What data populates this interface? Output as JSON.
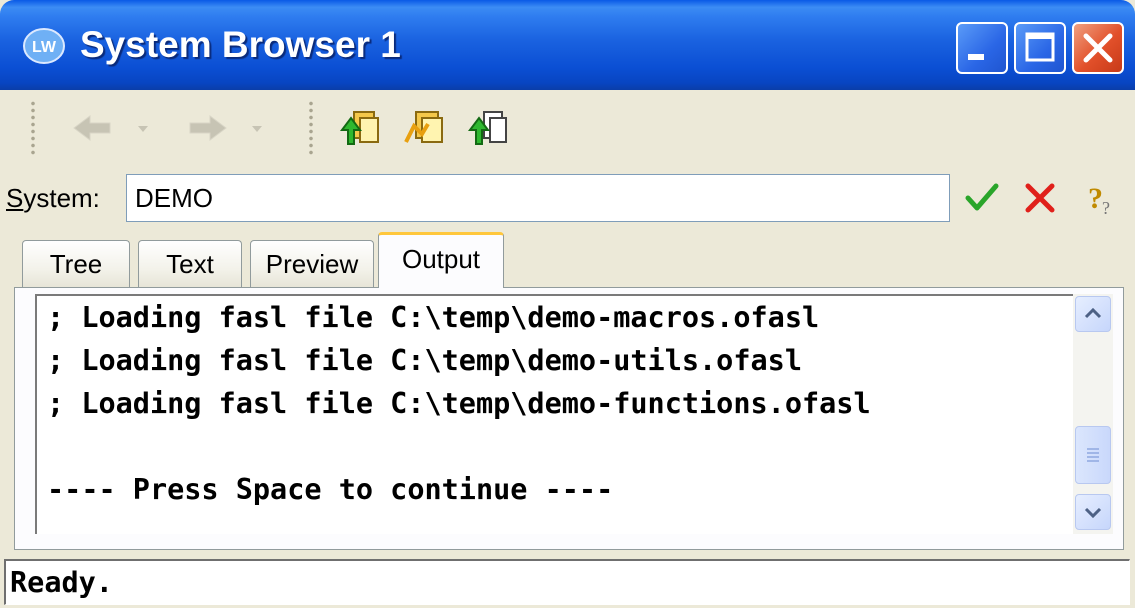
{
  "window": {
    "title": "System Browser 1",
    "icon": "lispworks-app-icon",
    "controls": [
      "minimize-icon",
      "maximize-icon",
      "close-icon"
    ]
  },
  "toolbar": {
    "items": [
      {
        "name": "back-arrow-icon",
        "enabled": false
      },
      {
        "name": "back-dropdown-icon",
        "enabled": false
      },
      {
        "name": "forward-arrow-icon",
        "enabled": false
      },
      {
        "name": "forward-dropdown-icon",
        "enabled": false
      },
      {
        "name": "compile-and-load-icon",
        "enabled": true
      },
      {
        "name": "compile-icon",
        "enabled": true
      },
      {
        "name": "load-icon",
        "enabled": true
      }
    ]
  },
  "system_row": {
    "label_prefix": "S",
    "label_rest": "ystem:",
    "value": "DEMO",
    "actions": [
      "confirm-check-icon",
      "cancel-x-icon",
      "help-question-icon"
    ]
  },
  "tabs": [
    {
      "label": "Tree",
      "active": false
    },
    {
      "label": "Text",
      "active": false
    },
    {
      "label": "Preview",
      "active": false
    },
    {
      "label": "Output",
      "active": true
    }
  ],
  "output": {
    "lines": [
      "; Loading fasl file C:\\temp\\demo-macros.ofasl",
      "; Loading fasl file C:\\temp\\demo-utils.ofasl",
      "; Loading fasl file C:\\temp\\demo-functions.ofasl",
      "",
      "---- Press Space to continue ----"
    ]
  },
  "status": {
    "text": "Ready."
  },
  "colors": {
    "titlebar": "#0a5ae6",
    "window_bg": "#ece9d8",
    "active_tab_accent": "#ffc73c",
    "close_button": "#e2502a",
    "check_green": "#2aa52a",
    "cancel_red": "#e0201a"
  }
}
